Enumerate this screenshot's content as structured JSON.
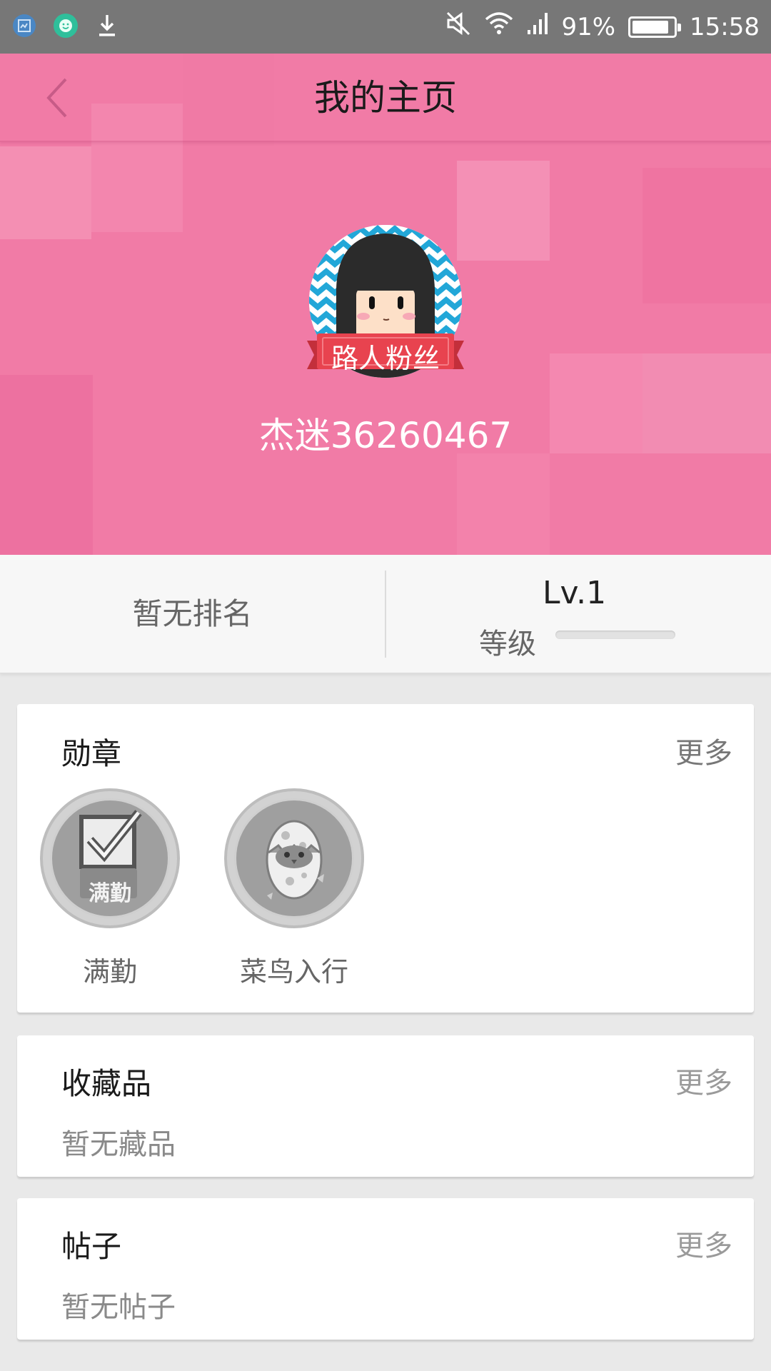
{
  "status_bar": {
    "icons_left": [
      "screenshot-icon",
      "face-app-icon",
      "download-icon"
    ],
    "icons_right": [
      "mute-icon",
      "wifi-icon",
      "signal-icon"
    ],
    "battery_percent": "91%",
    "battery_level": 0.91,
    "time": "15:58"
  },
  "header": {
    "title": "我的主页",
    "back_icon": "chevron-left-icon",
    "avatar_badge": "路人粉丝",
    "username": "杰迷36260467"
  },
  "stats": {
    "rank": "暂无排名",
    "level_value": "Lv.1",
    "level_label": "等级",
    "level_progress": 0
  },
  "medals": {
    "title": "勋章",
    "more": "更多",
    "items": [
      {
        "label": "满勤",
        "icon": "full-attendance-icon",
        "icon_text": "满勤"
      },
      {
        "label": "菜鸟入行",
        "icon": "hatching-chick-icon"
      }
    ]
  },
  "collections": {
    "title": "收藏品",
    "more": "更多",
    "empty": "暂无藏品"
  },
  "posts": {
    "title": "帖子",
    "more": "更多",
    "empty": "暂无帖子"
  },
  "colors": {
    "hero_pink": "#f17ba6",
    "ribbon_red": "#e8434f",
    "avatar_stripe": "#22a7d8"
  }
}
